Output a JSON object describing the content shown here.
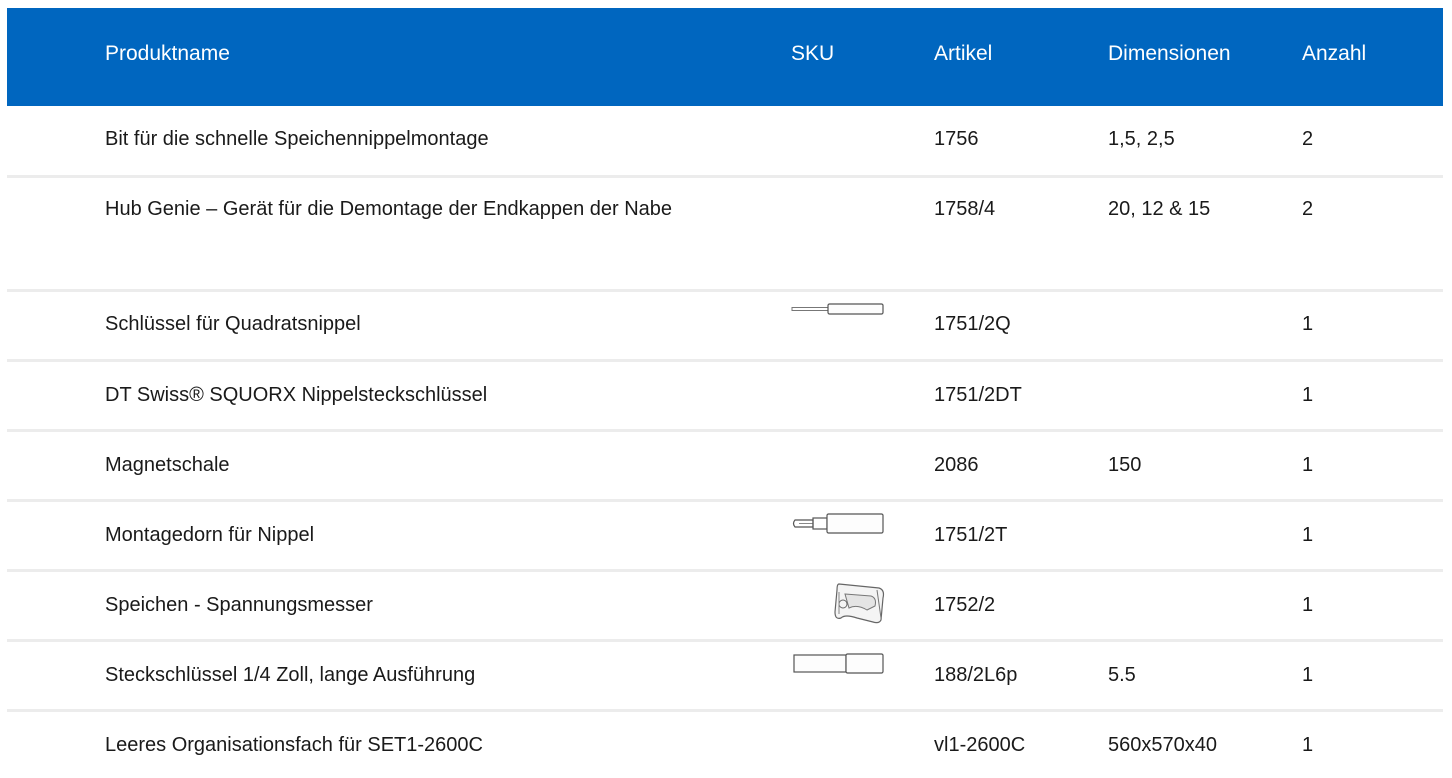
{
  "columns": {
    "name": "Produktname",
    "sku": "SKU",
    "article": "Artikel",
    "dimensions": "Dimensionen",
    "quantity": "Anzahl"
  },
  "rows": [
    {
      "name": "Bit für die schnelle Speichennippelmontage",
      "sku_image": "",
      "article": "1756",
      "dimensions": "1,5, 2,5",
      "quantity": "2"
    },
    {
      "name": "Hub Genie – Gerät für die Demontage der Endkappen der Nabe",
      "sku_image": "",
      "article": "1758/4",
      "dimensions": "20, 12 & 15",
      "quantity": "2"
    },
    {
      "name": "Schlüssel für Quadratsnippel",
      "sku_image": "screwdriver-thumbnail",
      "article": "1751/2Q",
      "dimensions": "",
      "quantity": "1"
    },
    {
      "name": "DT Swiss® SQUORX Nippelsteckschlüssel",
      "sku_image": "",
      "article": "1751/2DT",
      "dimensions": "",
      "quantity": "1"
    },
    {
      "name": "Magnetschale",
      "sku_image": "",
      "article": "2086",
      "dimensions": "150",
      "quantity": "1"
    },
    {
      "name": "Montagedorn für Nippel",
      "sku_image": "mandrel-thumbnail",
      "article": "1751/2T",
      "dimensions": "",
      "quantity": "1"
    },
    {
      "name": "Speichen - Spannungsmesser",
      "sku_image": "tension-meter-thumbnail",
      "article": "1752/2",
      "dimensions": "",
      "quantity": "1"
    },
    {
      "name": "Steckschlüssel 1/4 Zoll, lange Ausführung",
      "sku_image": "socket-thumbnail",
      "article": "188/2L6p",
      "dimensions": "5.5",
      "quantity": "1"
    },
    {
      "name": "Leeres Organisationsfach für SET1-2600C",
      "sku_image": "",
      "article": "vl1-2600C",
      "dimensions": "560x570x40",
      "quantity": "1"
    }
  ]
}
